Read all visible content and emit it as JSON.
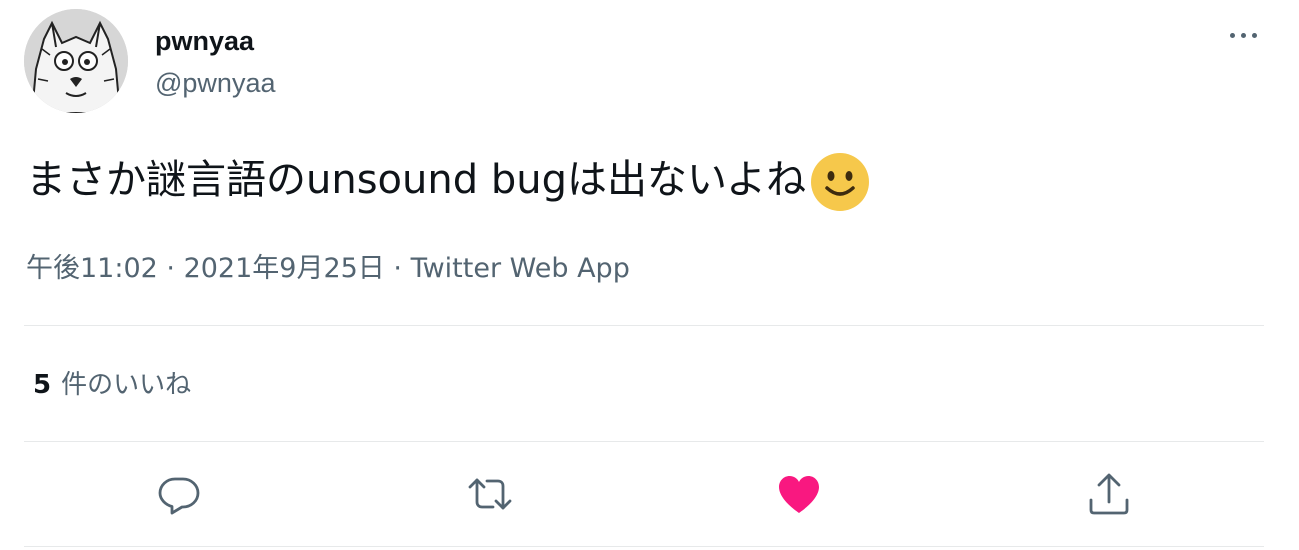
{
  "user": {
    "display_name": "pwnyaa",
    "handle": "@pwnyaa"
  },
  "tweet": {
    "text": "まさか謎言語のunsound bugは出ないよね",
    "emoji": "slightly-smiling-face"
  },
  "meta": {
    "time": "午後11:02",
    "separator1": " · ",
    "date": "2021年9月25日",
    "separator2": " · ",
    "source": "Twitter Web App"
  },
  "stats": {
    "likes_count": "5",
    "likes_label": "件のいいね"
  },
  "actions": {
    "reply": "reply-icon",
    "retweet": "retweet-icon",
    "like": "heart-icon",
    "share": "share-icon",
    "like_color": "#f91880",
    "icon_color": "#536471"
  },
  "colors": {
    "secondary_text": "#536471",
    "divider": "#e7e9ea",
    "emoji_face": "#f6c84b"
  }
}
